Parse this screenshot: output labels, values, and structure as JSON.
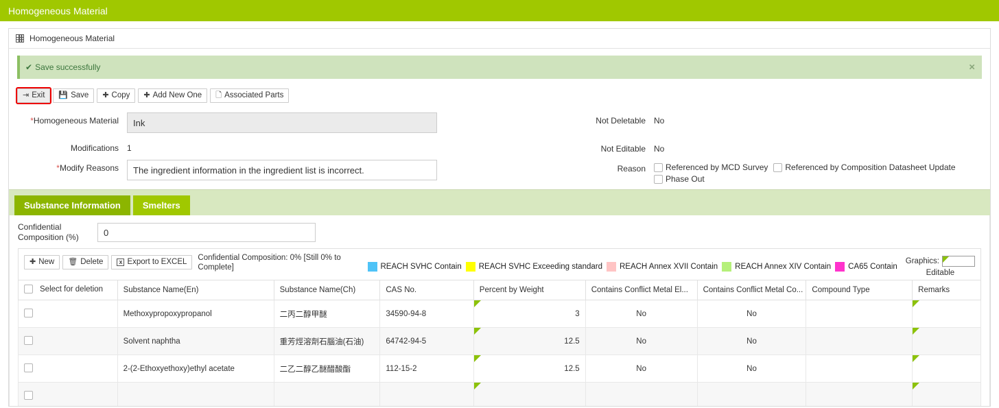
{
  "window": {
    "title": "Homogeneous Material"
  },
  "panel": {
    "header": "Homogeneous Material",
    "icon": "grid-icon"
  },
  "alert": {
    "text": "Save successfully",
    "check_icon": "check-icon",
    "close_icon": "close-icon"
  },
  "toolbar": {
    "buttons": [
      {
        "label": "Exit",
        "icon": "exit-icon",
        "highlighted": true
      },
      {
        "label": "Save",
        "icon": "save-disk-icon",
        "highlighted": false
      },
      {
        "label": "Copy",
        "icon": "plus-icon",
        "highlighted": false
      },
      {
        "label": "Add New One",
        "icon": "plus-icon",
        "highlighted": false
      },
      {
        "label": "Associated Parts",
        "icon": "document-icon",
        "highlighted": false
      }
    ]
  },
  "form": {
    "homogeneous_material": {
      "label": "Homogeneous Material",
      "required": "*",
      "value": "Ink"
    },
    "modifications": {
      "label": "Modifications",
      "value": "1"
    },
    "modify_reasons": {
      "label": "Modify Reasons",
      "required": "*",
      "value": "The ingredient information in the ingredient list is incorrect."
    },
    "not_deletable": {
      "label": "Not Deletable",
      "value": "No"
    },
    "not_editable": {
      "label": "Not Editable",
      "value": "No"
    },
    "reason": {
      "label": "Reason",
      "checkboxes": [
        {
          "label": "Referenced by MCD Survey",
          "checked": false
        },
        {
          "label": "Referenced by Composition Datasheet Update",
          "checked": false
        },
        {
          "label": "Phase Out",
          "checked": false
        }
      ]
    }
  },
  "tabs": [
    {
      "label": "Substance Information",
      "active": true
    },
    {
      "label": "Smelters",
      "active": false
    }
  ],
  "confidential": {
    "label_line1": "Confidential",
    "label_line2": "Composition (%)",
    "value": "0"
  },
  "grid_toolbar": {
    "buttons": [
      {
        "label": "New",
        "icon": "plus-icon"
      },
      {
        "label": "Delete",
        "icon": "trash-icon"
      },
      {
        "label": "Export to EXCEL",
        "icon": "excel-icon"
      }
    ],
    "note": "Confidential Composition: 0% [Still 0% to Complete]",
    "graphics_label": "Graphics:",
    "editable_label": "Editable"
  },
  "legend": [
    {
      "label": "REACH SVHC Contain",
      "color": "#4fc3f7"
    },
    {
      "label": "REACH SVHC Exceeding standard",
      "color": "#ffff00"
    },
    {
      "label": "REACH Annex XVII Contain",
      "color": "#ffc4c4"
    },
    {
      "label": "REACH Annex XIV Contain",
      "color": "#b5f07a"
    },
    {
      "label": "CA65 Contain",
      "color": "#ff33cc"
    }
  ],
  "table": {
    "columns": [
      "Select for deletion",
      "Substance Name(En)",
      "Substance Name(Ch)",
      "CAS No.",
      "Percent by Weight",
      "Contains Conflict Metal El...",
      "Contains Conflict Metal Co...",
      "Compound Type",
      "Remarks"
    ],
    "rows": [
      {
        "selected": false,
        "name_en": "Methoxypropoxypropanol",
        "name_ch": "二丙二醇甲醚",
        "cas": "34590-94-8",
        "percent": "3",
        "conflict_metal_el": "No",
        "conflict_metal_co": "No",
        "compound_type": "",
        "remarks": ""
      },
      {
        "selected": false,
        "name_en": "Solvent naphtha",
        "name_ch": "重芳烴溶劑石腦油(石油)",
        "cas": "64742-94-5",
        "percent": "12.5",
        "conflict_metal_el": "No",
        "conflict_metal_co": "No",
        "compound_type": "",
        "remarks": ""
      },
      {
        "selected": false,
        "name_en": "2-(2-Ethoxyethoxy)ethyl acetate",
        "name_ch": "二乙二醇乙醚醋酸酯",
        "cas": "112-15-2",
        "percent": "12.5",
        "conflict_metal_el": "No",
        "conflict_metal_co": "No",
        "compound_type": "",
        "remarks": ""
      }
    ]
  },
  "colors": {
    "brand_green": "#a0c800",
    "alert_bg": "#cfe3bd",
    "alert_text": "#3c763d",
    "marker_green": "#8cc20a",
    "highlight_red": "#ee0000"
  }
}
